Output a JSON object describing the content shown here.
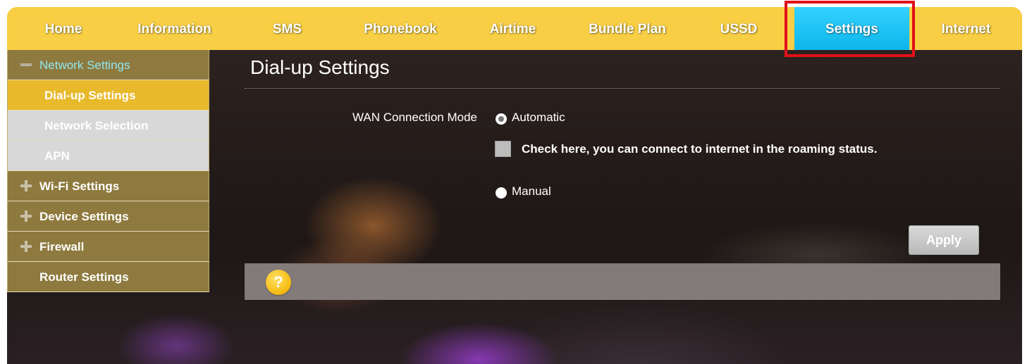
{
  "nav": {
    "items": [
      {
        "label": "Home"
      },
      {
        "label": "Information"
      },
      {
        "label": "SMS"
      },
      {
        "label": "Phonebook"
      },
      {
        "label": "Airtime"
      },
      {
        "label": "Bundle Plan"
      },
      {
        "label": "USSD"
      },
      {
        "label": "Settings",
        "active": true
      },
      {
        "label": "Internet"
      }
    ]
  },
  "sidebar": {
    "groups": [
      {
        "label": "Network Settings",
        "expanded": true,
        "icon": "minus-icon",
        "items": [
          {
            "label": "Dial-up Settings",
            "selected": true
          },
          {
            "label": "Network Selection"
          },
          {
            "label": "APN"
          }
        ]
      },
      {
        "label": "Wi-Fi Settings",
        "icon": "plus-icon"
      },
      {
        "label": "Device Settings",
        "icon": "plus-icon"
      },
      {
        "label": "Firewall",
        "icon": "plus-icon"
      },
      {
        "label": "Router Settings"
      }
    ]
  },
  "main": {
    "title": "Dial-up Settings",
    "wan_label": "WAN Connection Mode",
    "option_automatic": "Automatic",
    "roaming_check_label": "Check here, you can connect to internet in the roaming status.",
    "option_manual": "Manual",
    "selected_mode": "Automatic",
    "apply_label": "Apply",
    "help_glyph": "?"
  },
  "colors": {
    "nav_bg": "#f8cf44",
    "active_tab": "#16bdf0",
    "highlight_outline": "#e31017",
    "sidebar_group": "#8e7a3e",
    "sidebar_selected": "#e9b92c",
    "sidebar_sub": "#d8d8d8"
  }
}
